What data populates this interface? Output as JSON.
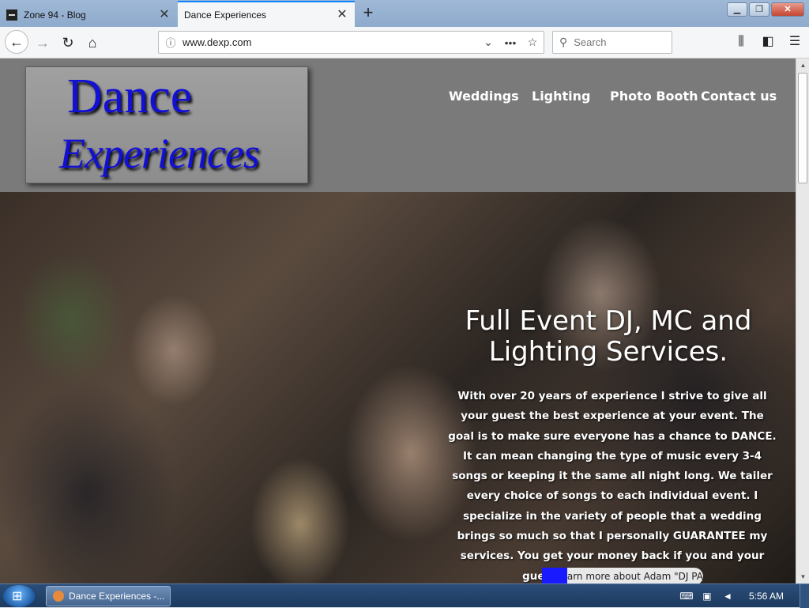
{
  "browser": {
    "tabs": [
      {
        "label": "Zone 94 - Blog",
        "active": false
      },
      {
        "label": "Dance Experiences",
        "active": true
      }
    ],
    "new_tab_icon": "plus-icon",
    "url": "www.dexp.com",
    "search_placeholder": "Search"
  },
  "site": {
    "logo_line1": "Dance",
    "logo_line2": "Experiences",
    "nav": [
      "Weddings",
      "Lighting",
      "Photo Booth",
      "Contact us"
    ],
    "hero_title": "Full Event DJ, MC and Lighting Services.",
    "hero_text": "With over 20 years of experience I strive to give all your guest the best experience at your event.  The goal is to make sure everyone has a chance to DANCE.  It can mean changing the type of music every 3-4 songs or keeping it the same all night long.  We tailer every choice of songs to each individual event.  I specialize in the variety of people  that a wedding brings so much so that I personally GUARANTEE  my services.  You get your money back if you and your guest didn't enjoy your night!",
    "learn_more": "Learn more about Adam \"DJ PAZ\"",
    "colors": {
      "logo_blue": "#1310d6",
      "header_gray": "#7a7a7a",
      "learn_blue": "#1a1aff"
    }
  },
  "taskbar": {
    "window_label": "Dance Experiences -...",
    "clock": "5:56 AM"
  }
}
